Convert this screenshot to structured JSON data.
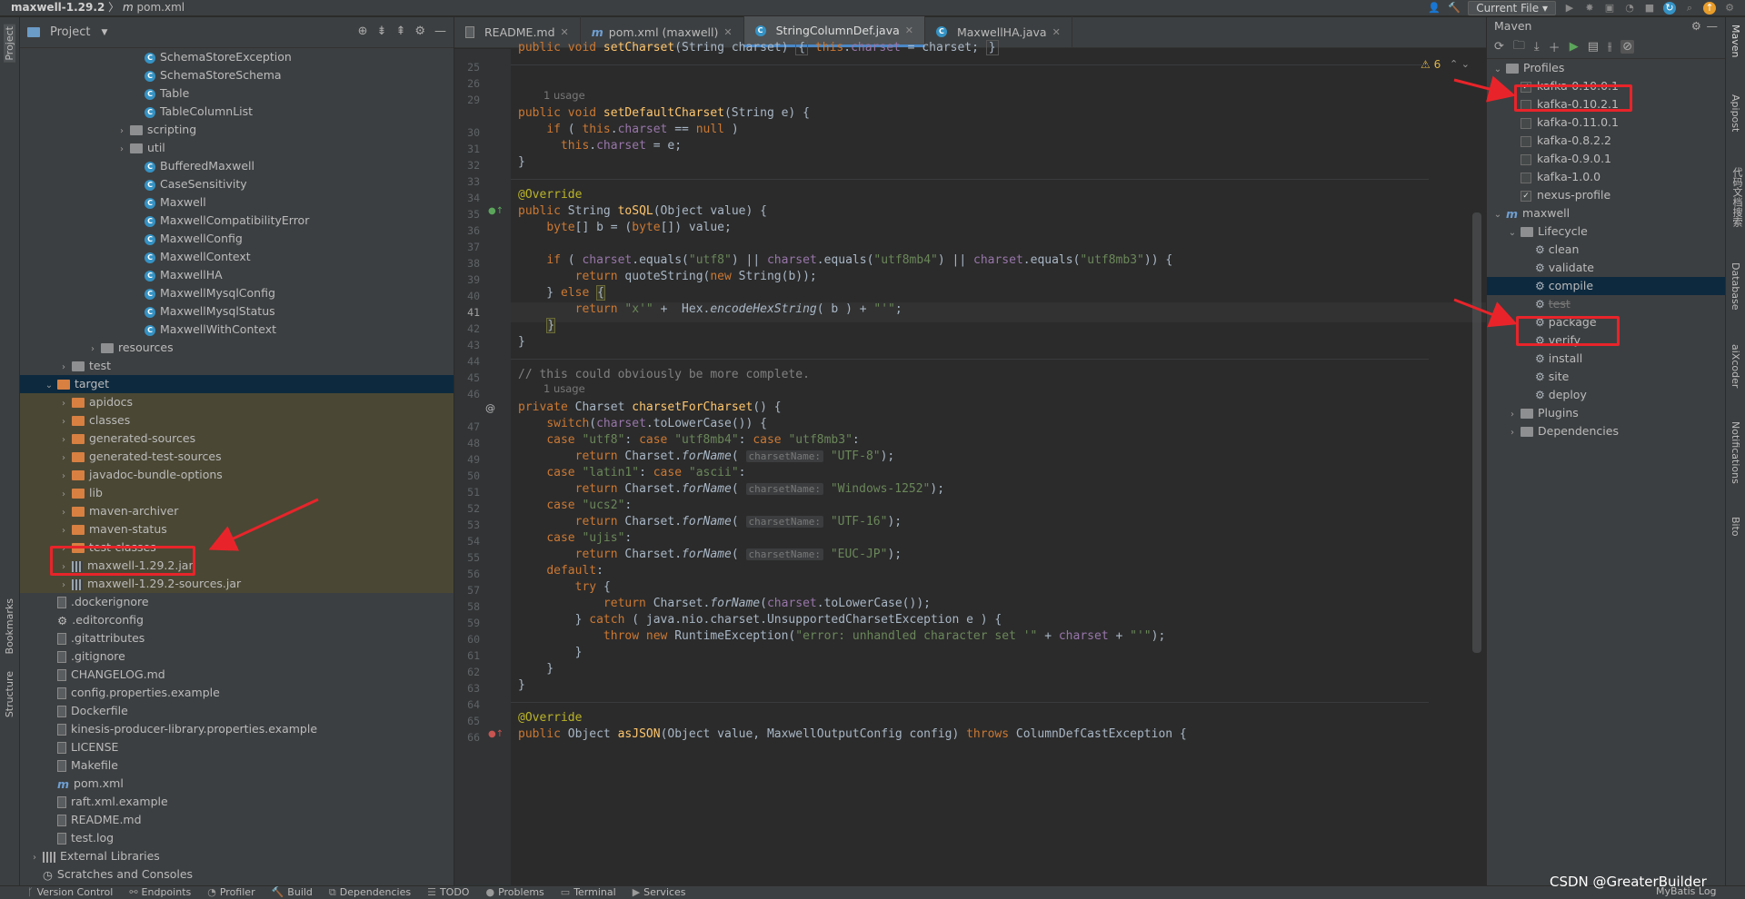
{
  "titlebar": {
    "project": "maxwell-1.29.2",
    "file": "pom.xml",
    "run_config": "Current File"
  },
  "left_strip": {
    "project": "Project",
    "bookmarks": "Bookmarks",
    "structure": "Structure"
  },
  "right_strip": {
    "maven": "Maven",
    "apipost": "Apipost",
    "docs": "代码文档搜索",
    "database": "Database",
    "aixcoder": "aiXcoder",
    "notifications": "Notifications",
    "bito": "Bito"
  },
  "project_panel": {
    "title": "Project",
    "tree": [
      {
        "label": "SchemaStoreException",
        "icon": "class"
      },
      {
        "label": "SchemaStoreSchema",
        "icon": "class"
      },
      {
        "label": "Table",
        "icon": "class"
      },
      {
        "label": "TableColumnList",
        "icon": "class"
      },
      {
        "label": "scripting",
        "icon": "folder-gray"
      },
      {
        "label": "util",
        "icon": "folder-gray"
      },
      {
        "label": "BufferedMaxwell",
        "icon": "class"
      },
      {
        "label": "CaseSensitivity",
        "icon": "class"
      },
      {
        "label": "Maxwell",
        "icon": "class"
      },
      {
        "label": "MaxwellCompatibilityError",
        "icon": "class"
      },
      {
        "label": "MaxwellConfig",
        "icon": "class"
      },
      {
        "label": "MaxwellContext",
        "icon": "class"
      },
      {
        "label": "MaxwellHA",
        "icon": "class"
      },
      {
        "label": "MaxwellMysqlConfig",
        "icon": "class"
      },
      {
        "label": "MaxwellMysqlStatus",
        "icon": "class"
      },
      {
        "label": "MaxwellWithContext",
        "icon": "class"
      },
      {
        "label": "resources",
        "icon": "folder-gray"
      },
      {
        "label": "test",
        "icon": "folder-gray"
      },
      {
        "label": "target",
        "icon": "folder"
      },
      {
        "label": "apidocs",
        "icon": "folder"
      },
      {
        "label": "classes",
        "icon": "folder"
      },
      {
        "label": "generated-sources",
        "icon": "folder"
      },
      {
        "label": "generated-test-sources",
        "icon": "folder"
      },
      {
        "label": "javadoc-bundle-options",
        "icon": "folder"
      },
      {
        "label": "lib",
        "icon": "folder"
      },
      {
        "label": "maven-archiver",
        "icon": "folder"
      },
      {
        "label": "maven-status",
        "icon": "folder"
      },
      {
        "label": "test-classes",
        "icon": "folder"
      },
      {
        "label": "maxwell-1.29.2.jar",
        "icon": "jar"
      },
      {
        "label": "maxwell-1.29.2-sources.jar",
        "icon": "jar"
      },
      {
        "label": ".dockerignore",
        "icon": "file"
      },
      {
        "label": ".editorconfig",
        "icon": "gear"
      },
      {
        "label": ".gitattributes",
        "icon": "file"
      },
      {
        "label": ".gitignore",
        "icon": "file"
      },
      {
        "label": "CHANGELOG.md",
        "icon": "md"
      },
      {
        "label": "config.properties.example",
        "icon": "file"
      },
      {
        "label": "Dockerfile",
        "icon": "file"
      },
      {
        "label": "kinesis-producer-library.properties.example",
        "icon": "file"
      },
      {
        "label": "LICENSE",
        "icon": "file"
      },
      {
        "label": "Makefile",
        "icon": "file"
      },
      {
        "label": "pom.xml",
        "icon": "maven"
      },
      {
        "label": "raft.xml.example",
        "icon": "file"
      },
      {
        "label": "README.md",
        "icon": "md"
      },
      {
        "label": "test.log",
        "icon": "file"
      },
      {
        "label": "External Libraries",
        "icon": "lib"
      },
      {
        "label": "Scratches and Consoles",
        "icon": "scratch"
      }
    ]
  },
  "tabs": [
    {
      "label": "README.md",
      "active": false
    },
    {
      "label": "pom.xml (maxwell)",
      "active": false
    },
    {
      "label": "StringColumnDef.java",
      "active": true
    },
    {
      "label": "MaxwellHA.java",
      "active": false
    }
  ],
  "editor": {
    "warnings": "6",
    "usage_hint": "1 usage",
    "param_hint": "charsetName:",
    "line_numbers": [
      "25",
      "26",
      "29",
      "30",
      "31",
      "32",
      "33",
      "34",
      "35",
      "36",
      "37",
      "38",
      "39",
      "40",
      "41",
      "42",
      "43",
      "44",
      "45",
      "46",
      "47",
      "48",
      "49",
      "50",
      "51",
      "52",
      "53",
      "54",
      "55",
      "56",
      "57",
      "58",
      "59",
      "60",
      "61",
      "62",
      "63",
      "64",
      "65",
      "66"
    ]
  },
  "maven": {
    "title": "Maven",
    "profiles_label": "Profiles",
    "profiles": [
      {
        "name": "kafka-0.10.0.1",
        "checked": true
      },
      {
        "name": "kafka-0.10.2.1",
        "checked": false
      },
      {
        "name": "kafka-0.11.0.1",
        "checked": false
      },
      {
        "name": "kafka-0.8.2.2",
        "checked": false
      },
      {
        "name": "kafka-0.9.0.1",
        "checked": false
      },
      {
        "name": "kafka-1.0.0",
        "checked": false
      },
      {
        "name": "nexus-profile",
        "checked": true
      }
    ],
    "project": "maxwell",
    "lifecycle_label": "Lifecycle",
    "lifecycle": [
      "clean",
      "validate",
      "compile",
      "test",
      "package",
      "verify",
      "install",
      "site",
      "deploy"
    ],
    "plugins_label": "Plugins",
    "dependencies_label": "Dependencies"
  },
  "statusbar": [
    "Version Control",
    "Endpoints",
    "Profiler",
    "Build",
    "Dependencies",
    "TODO",
    "Problems",
    "Terminal",
    "Services"
  ],
  "statusbar_right": "MyBatis Log",
  "watermark": "CSDN @GreaterBuilder",
  "colors": {
    "accent": "#4a88c7",
    "annotation": "#e8242a",
    "selection": "#0d293e"
  }
}
